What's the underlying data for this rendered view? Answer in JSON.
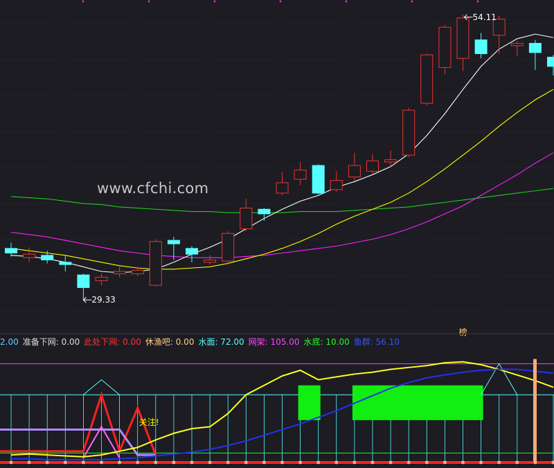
{
  "watermark": "www.cfchi.com",
  "colors": {
    "bg": "#1c1c22",
    "up": "#ee3333",
    "down": "#55ffff",
    "ma5": "#ffffff",
    "ma10": "#ffff00",
    "ma20": "#ff22ff",
    "ma60": "#22cc22",
    "grid": "#333340"
  },
  "legend": [
    {
      "label": "2.00",
      "color": "#66ccff"
    },
    {
      "label": "准备下网: 0.00",
      "color": "#dddddd"
    },
    {
      "label": "此处下网: 0.00",
      "color": "#ff3333"
    },
    {
      "label": "休渔吧: 0.00",
      "color": "#ffcc88"
    },
    {
      "label": "水面: 72.00",
      "color": "#55ffff"
    },
    {
      "label": "网架: 105.00",
      "color": "#ff44ff"
    },
    {
      "label": "水底: 10.00",
      "color": "#22ff22"
    },
    {
      "label": "鱼群: 56.10",
      "color": "#3355ff"
    }
  ],
  "chart_data": [
    {
      "type": "candlestick",
      "annotations": {
        "high_label": "54.11",
        "low_label": "29.33",
        "marker": "榜"
      },
      "ylim": [
        27,
        55
      ],
      "candles": [
        {
          "o": 33.8,
          "c": 33.4,
          "h": 34.3,
          "l": 33.1
        },
        {
          "o": 33.0,
          "c": 33.3,
          "h": 33.9,
          "l": 32.6
        },
        {
          "o": 33.2,
          "c": 32.8,
          "h": 33.6,
          "l": 32.5
        },
        {
          "o": 32.6,
          "c": 32.4,
          "h": 33.2,
          "l": 31.8
        },
        {
          "o": 31.5,
          "c": 30.4,
          "h": 31.6,
          "l": 29.33
        },
        {
          "o": 31.0,
          "c": 31.3,
          "h": 31.6,
          "l": 30.6
        },
        {
          "o": 31.6,
          "c": 31.8,
          "h": 32.4,
          "l": 31.3
        },
        {
          "o": 31.6,
          "c": 31.9,
          "h": 32.2,
          "l": 31.4
        },
        {
          "o": 30.6,
          "c": 34.4,
          "h": 34.6,
          "l": 30.5
        },
        {
          "o": 34.5,
          "c": 34.2,
          "h": 34.8,
          "l": 32.8
        },
        {
          "o": 33.8,
          "c": 33.3,
          "h": 34.0,
          "l": 32.6
        },
        {
          "o": 32.6,
          "c": 32.8,
          "h": 33.2,
          "l": 32.4
        },
        {
          "o": 32.7,
          "c": 35.1,
          "h": 35.3,
          "l": 32.4
        },
        {
          "o": 35.5,
          "c": 37.3,
          "h": 38.1,
          "l": 35.3
        },
        {
          "o": 37.2,
          "c": 36.8,
          "h": 37.3,
          "l": 36.2
        },
        {
          "o": 38.6,
          "c": 39.5,
          "h": 40.4,
          "l": 38.4
        },
        {
          "o": 39.8,
          "c": 40.6,
          "h": 41.3,
          "l": 39.3
        },
        {
          "o": 41.0,
          "c": 38.6,
          "h": 41.1,
          "l": 38.5
        },
        {
          "o": 38.9,
          "c": 39.7,
          "h": 40.5,
          "l": 38.7
        },
        {
          "o": 40.0,
          "c": 41.0,
          "h": 42.1,
          "l": 39.7
        },
        {
          "o": 40.5,
          "c": 41.4,
          "h": 42.0,
          "l": 40.2
        },
        {
          "o": 41.3,
          "c": 41.5,
          "h": 42.3,
          "l": 40.9
        },
        {
          "o": 41.9,
          "c": 45.8,
          "h": 46.0,
          "l": 41.7
        },
        {
          "o": 46.4,
          "c": 50.6,
          "h": 50.7,
          "l": 46.2
        },
        {
          "o": 49.5,
          "c": 53.0,
          "h": 53.2,
          "l": 48.9
        },
        {
          "o": 50.3,
          "c": 53.8,
          "h": 54.11,
          "l": 49.2
        },
        {
          "o": 51.9,
          "c": 50.7,
          "h": 52.5,
          "l": 50.3
        },
        {
          "o": 52.3,
          "c": 53.7,
          "h": 54.0,
          "l": 50.7
        },
        {
          "o": 51.4,
          "c": 51.6,
          "h": 51.8,
          "l": 50.5
        },
        {
          "o": 51.6,
          "c": 50.8,
          "h": 51.9,
          "l": 49.3
        },
        {
          "o": 50.4,
          "c": 49.6,
          "h": 50.6,
          "l": 48.8
        }
      ],
      "ma5": [
        33.2,
        33.1,
        32.9,
        32.6,
        32.2,
        31.8,
        31.7,
        31.8,
        32.0,
        32.6,
        33.3,
        33.9,
        34.6,
        35.5,
        36.4,
        37.2,
        37.9,
        38.4,
        39.1,
        39.6,
        40.2,
        40.9,
        42.0,
        43.6,
        45.5,
        47.6,
        49.6,
        51.1,
        52.0,
        52.4,
        52.1
      ],
      "ma10": [
        33.8,
        33.6,
        33.4,
        33.2,
        32.9,
        32.6,
        32.3,
        32.1,
        32.0,
        32.0,
        32.1,
        32.2,
        32.5,
        32.9,
        33.3,
        33.8,
        34.4,
        35.1,
        35.9,
        36.6,
        37.2,
        37.8,
        38.6,
        39.6,
        40.7,
        41.9,
        43.1,
        44.4,
        45.6,
        46.7,
        47.6
      ],
      "ma20": [
        35.2,
        35.0,
        34.8,
        34.5,
        34.2,
        33.9,
        33.6,
        33.4,
        33.2,
        33.1,
        33.0,
        33.0,
        33.0,
        33.1,
        33.2,
        33.4,
        33.6,
        33.8,
        34.0,
        34.3,
        34.6,
        35.0,
        35.5,
        36.1,
        36.8,
        37.5,
        38.4,
        39.3,
        40.2,
        41.2,
        42.1
      ],
      "ma60": [
        38.3,
        38.2,
        38.1,
        37.9,
        37.7,
        37.6,
        37.4,
        37.3,
        37.2,
        37.1,
        37.0,
        37.0,
        36.9,
        36.9,
        36.9,
        36.9,
        37.0,
        37.0,
        37.0,
        37.1,
        37.2,
        37.3,
        37.4,
        37.6,
        37.8,
        38.0,
        38.2,
        38.4,
        38.6,
        38.8,
        39.0
      ]
    },
    {
      "type": "line",
      "title": "",
      "ylim": [
        0,
        120
      ],
      "series": [
        {
          "name": "准备下网",
          "values": [
            0,
            0,
            0,
            0,
            0,
            0,
            0,
            0,
            0,
            0,
            0,
            0,
            0,
            0,
            0,
            0,
            0,
            0,
            0,
            0,
            0,
            0,
            0,
            0,
            0,
            0,
            0,
            0,
            0,
            0,
            0
          ]
        },
        {
          "name": "此处下网",
          "values": [
            0,
            0,
            0,
            0,
            0,
            0,
            0,
            0,
            0,
            0,
            0,
            0,
            0,
            0,
            0,
            0,
            0,
            0,
            0,
            0,
            0,
            0,
            0,
            0,
            0,
            0,
            0,
            0,
            0,
            0,
            0
          ]
        },
        {
          "name": "休渔吧",
          "values": [
            0,
            0,
            0,
            0,
            0,
            0,
            0,
            0,
            0,
            0,
            0,
            0,
            0,
            0,
            0,
            0,
            0,
            0,
            0,
            0,
            0,
            0,
            0,
            0,
            0,
            0,
            0,
            0,
            0,
            0,
            0
          ]
        },
        {
          "name": "水面",
          "values": [
            72,
            72,
            72,
            72,
            72,
            72,
            72,
            72,
            72,
            72,
            72,
            72,
            72,
            72,
            72,
            72,
            72,
            72,
            72,
            72,
            72,
            72,
            72,
            72,
            72,
            72,
            72,
            72,
            72,
            72,
            72
          ]
        },
        {
          "name": "网架",
          "values": [
            105,
            105,
            105,
            105,
            105,
            105,
            105,
            105,
            105,
            105,
            105,
            105,
            105,
            105,
            105,
            105,
            105,
            105,
            105,
            105,
            105,
            105,
            105,
            105,
            105,
            105,
            105,
            105,
            105,
            105,
            105
          ]
        },
        {
          "name": "水底",
          "values": [
            10,
            10,
            10,
            10,
            10,
            10,
            10,
            10,
            10,
            10,
            10,
            10,
            10,
            10,
            10,
            10,
            10,
            10,
            10,
            10,
            10,
            10,
            10,
            10,
            10,
            10,
            10,
            10,
            10,
            10,
            10
          ]
        },
        {
          "name": "鱼群",
          "values": [
            4,
            4,
            3,
            3,
            3,
            3,
            4,
            5,
            7,
            9,
            11,
            14,
            18,
            23,
            29,
            35,
            41,
            48,
            55,
            63,
            71,
            79,
            85,
            90,
            93,
            96,
            98,
            99,
            99,
            97,
            95
          ]
        },
        {
          "name": "",
          "values": [
            8,
            9,
            8,
            7,
            6,
            8,
            12,
            16,
            24,
            31,
            36,
            38,
            52,
            72,
            82,
            92,
            98,
            88,
            91,
            94,
            96,
            99,
            101,
            103,
            106,
            107,
            104,
            99,
            93,
            87,
            80
          ]
        }
      ],
      "spike_series": [
        0,
        0,
        0,
        0,
        0,
        88,
        0,
        0,
        0,
        0,
        0,
        0,
        0,
        0,
        0,
        0,
        0,
        0,
        0,
        0,
        0,
        0,
        0,
        0,
        0,
        0,
        0,
        105,
        0,
        0,
        0
      ],
      "signal_blocks": [
        {
          "from": 16,
          "to": 17
        },
        {
          "from": 19,
          "to": 26
        }
      ],
      "annotations": {
        "text": "关注!"
      }
    }
  ]
}
